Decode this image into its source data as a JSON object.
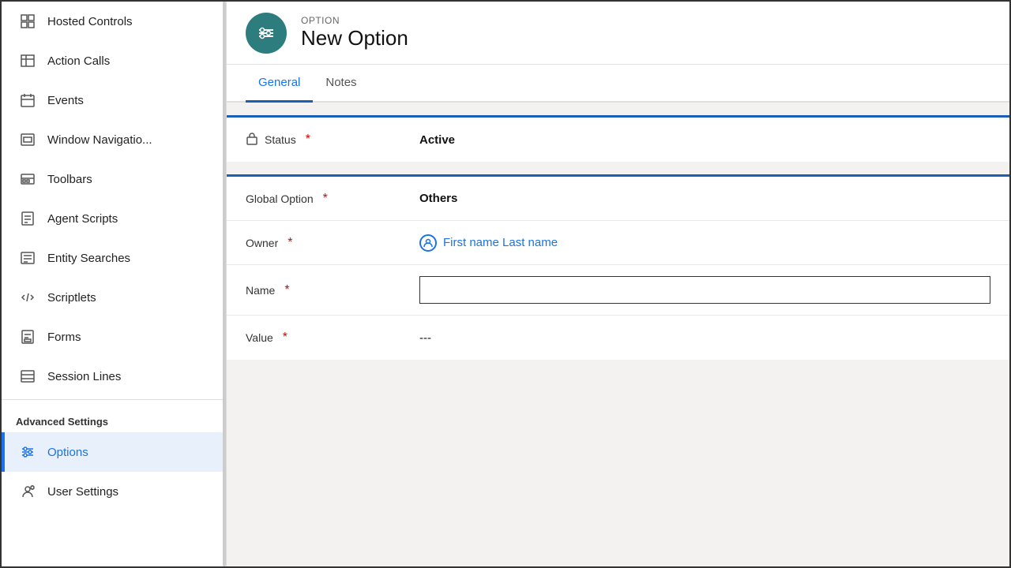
{
  "sidebar": {
    "items": [
      {
        "id": "hosted-controls",
        "label": "Hosted Controls",
        "icon": "grid",
        "active": false
      },
      {
        "id": "action-calls",
        "label": "Action Calls",
        "icon": "table",
        "active": false
      },
      {
        "id": "events",
        "label": "Events",
        "icon": "calendar",
        "active": false
      },
      {
        "id": "window-navigation",
        "label": "Window Navigatio...",
        "icon": "nav",
        "active": false
      },
      {
        "id": "toolbars",
        "label": "Toolbars",
        "icon": "toolbar",
        "active": false
      },
      {
        "id": "agent-scripts",
        "label": "Agent Scripts",
        "icon": "script",
        "active": false
      },
      {
        "id": "entity-searches",
        "label": "Entity Searches",
        "icon": "search-list",
        "active": false
      },
      {
        "id": "scriptlets",
        "label": "Scriptlets",
        "icon": "code",
        "active": false
      },
      {
        "id": "forms",
        "label": "Forms",
        "icon": "form",
        "active": false
      },
      {
        "id": "session-lines",
        "label": "Session Lines",
        "icon": "lines",
        "active": false
      }
    ],
    "advanced_section_label": "Advanced Settings",
    "advanced_items": [
      {
        "id": "options",
        "label": "Options",
        "icon": "options",
        "active": true
      },
      {
        "id": "user-settings",
        "label": "User Settings",
        "icon": "user-settings",
        "active": false
      }
    ]
  },
  "header": {
    "subtitle": "OPTION",
    "title": "New Option",
    "avatar_icon": "sliders"
  },
  "tabs": [
    {
      "id": "general",
      "label": "General",
      "active": true
    },
    {
      "id": "notes",
      "label": "Notes",
      "active": false
    }
  ],
  "form": {
    "sections": [
      {
        "id": "status-section",
        "rows": [
          {
            "id": "status",
            "label": "Status",
            "required": true,
            "value": "Active",
            "type": "lock-field",
            "bold": true
          }
        ]
      },
      {
        "id": "details-section",
        "rows": [
          {
            "id": "global-option",
            "label": "Global Option",
            "required": true,
            "value": "Others",
            "type": "text",
            "bold": true
          },
          {
            "id": "owner",
            "label": "Owner",
            "required": true,
            "value": "First name Last name",
            "type": "link"
          },
          {
            "id": "name",
            "label": "Name",
            "required": true,
            "value": "",
            "type": "input",
            "placeholder": ""
          },
          {
            "id": "value",
            "label": "Value",
            "required": true,
            "value": "---",
            "type": "text",
            "bold": false
          }
        ]
      }
    ]
  },
  "icons": {
    "grid": "⊞",
    "table": "▦",
    "calendar": "◫",
    "nav": "⊡",
    "toolbar": "▬",
    "script": "⊟",
    "search-list": "≡",
    "code": "</>",
    "form": "▣",
    "lines": "▤",
    "options": "≣",
    "user-settings": "👤",
    "sliders": "⊟",
    "lock": "🔒"
  }
}
